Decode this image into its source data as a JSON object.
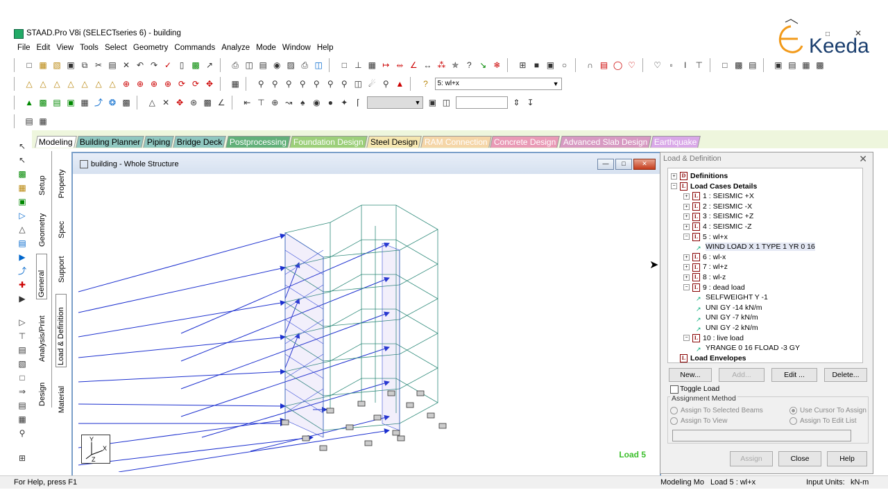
{
  "window": {
    "title": "STAAD.Pro V8i (SELECTseries 6) - building"
  },
  "logo": {
    "text": "Keeda"
  },
  "menu": [
    "File",
    "Edit",
    "View",
    "Tools",
    "Select",
    "Geometry",
    "Commands",
    "Analyze",
    "Mode",
    "Window",
    "Help"
  ],
  "toolbar": {
    "load_select": "5: wl+x"
  },
  "mode_tabs": [
    {
      "label": "Modeling",
      "color": "#ffffff",
      "text": "#000"
    },
    {
      "label": "Building Planner",
      "color": "#8fc7c0",
      "text": "#000"
    },
    {
      "label": "Piping",
      "color": "#8fc7c0",
      "text": "#000"
    },
    {
      "label": "Bridge Deck",
      "color": "#8fc7c0",
      "text": "#000"
    },
    {
      "label": "Postprocessing",
      "color": "#62b07a",
      "text": "#fff"
    },
    {
      "label": "Foundation Design",
      "color": "#9ccf7a",
      "text": "#fff"
    },
    {
      "label": "Steel Design",
      "color": "#f5e6b0",
      "text": "#000"
    },
    {
      "label": "RAM Connection",
      "color": "#f5d6a8",
      "text": "#fff"
    },
    {
      "label": "Concrete Design",
      "color": "#e99ab6",
      "text": "#fff"
    },
    {
      "label": "Advanced Slab Design",
      "color": "#d79ac2",
      "text": "#fff"
    },
    {
      "label": "Earthquake",
      "color": "#d9a8e8",
      "text": "#fff"
    }
  ],
  "page_control": {
    "outer": [
      "Setup",
      "Geometry",
      "General",
      "Analysis/Print",
      "Design"
    ],
    "inner": [
      "Property",
      "Spec",
      "Support",
      "Load & Definition",
      "Material"
    ]
  },
  "viewport": {
    "title": "building - Whole Structure",
    "load_label": "Load 5"
  },
  "panel": {
    "title": "Load & Definition",
    "tree": [
      {
        "level": 0,
        "pm": "+",
        "icon": "D",
        "text": "Definitions",
        "bold": true
      },
      {
        "level": 0,
        "pm": "-",
        "icon": "L",
        "text": "Load Cases Details",
        "bold": true
      },
      {
        "level": 1,
        "pm": "+",
        "icon": "L",
        "text": "1 : SEISMIC +X"
      },
      {
        "level": 1,
        "pm": "+",
        "icon": "L",
        "text": "2 : SEISMIC -X"
      },
      {
        "level": 1,
        "pm": "+",
        "icon": "L",
        "text": "3 : SEISMIC +Z"
      },
      {
        "level": 1,
        "pm": "+",
        "icon": "L",
        "text": "4 : SEISMIC -Z"
      },
      {
        "level": 1,
        "pm": "-",
        "icon": "L",
        "text": "5 : wl+x"
      },
      {
        "level": 2,
        "pm": "",
        "icon": "item",
        "text": "WIND LOAD X 1 TYPE 1 YR 0 16",
        "hl": true
      },
      {
        "level": 1,
        "pm": "+",
        "icon": "L",
        "text": "6 : wl-x"
      },
      {
        "level": 1,
        "pm": "+",
        "icon": "L",
        "text": "7 : wl+z"
      },
      {
        "level": 1,
        "pm": "+",
        "icon": "L",
        "text": "8 : wl-z"
      },
      {
        "level": 1,
        "pm": "-",
        "icon": "L",
        "text": "9 : dead load"
      },
      {
        "level": 2,
        "pm": "",
        "icon": "item",
        "text": "SELFWEIGHT Y -1"
      },
      {
        "level": 2,
        "pm": "",
        "icon": "item",
        "text": "UNI GY -14 kN/m"
      },
      {
        "level": 2,
        "pm": "",
        "icon": "item",
        "text": "UNI GY -7 kN/m"
      },
      {
        "level": 2,
        "pm": "",
        "icon": "item",
        "text": "UNI GY -2 kN/m"
      },
      {
        "level": 1,
        "pm": "-",
        "icon": "L",
        "text": "10 : live load"
      },
      {
        "level": 2,
        "pm": "",
        "icon": "item",
        "text": "YRANGE 0 16 FLOAD -3 GY"
      },
      {
        "level": 0,
        "pm": "",
        "icon": "L",
        "text": "Load Envelopes",
        "bold": true
      }
    ],
    "buttons": {
      "new": "New...",
      "add": "Add...",
      "edit": "Edit ...",
      "delete": "Delete..."
    },
    "toggle_load": "Toggle Load",
    "assignment_method": "Assignment Method",
    "radio_selected_beams": "Assign To Selected Beams",
    "radio_view": "Assign To View",
    "radio_cursor": "Use Cursor To Assign",
    "radio_edit_list": "Assign To Edit List",
    "footer": {
      "assign": "Assign",
      "close": "Close",
      "help": "Help"
    }
  },
  "status": {
    "help": "For Help, press F1",
    "mode": "Modeling Mo",
    "load": "Load 5 : wl+x",
    "units_label": "Input Units:",
    "units": "kN-m"
  }
}
